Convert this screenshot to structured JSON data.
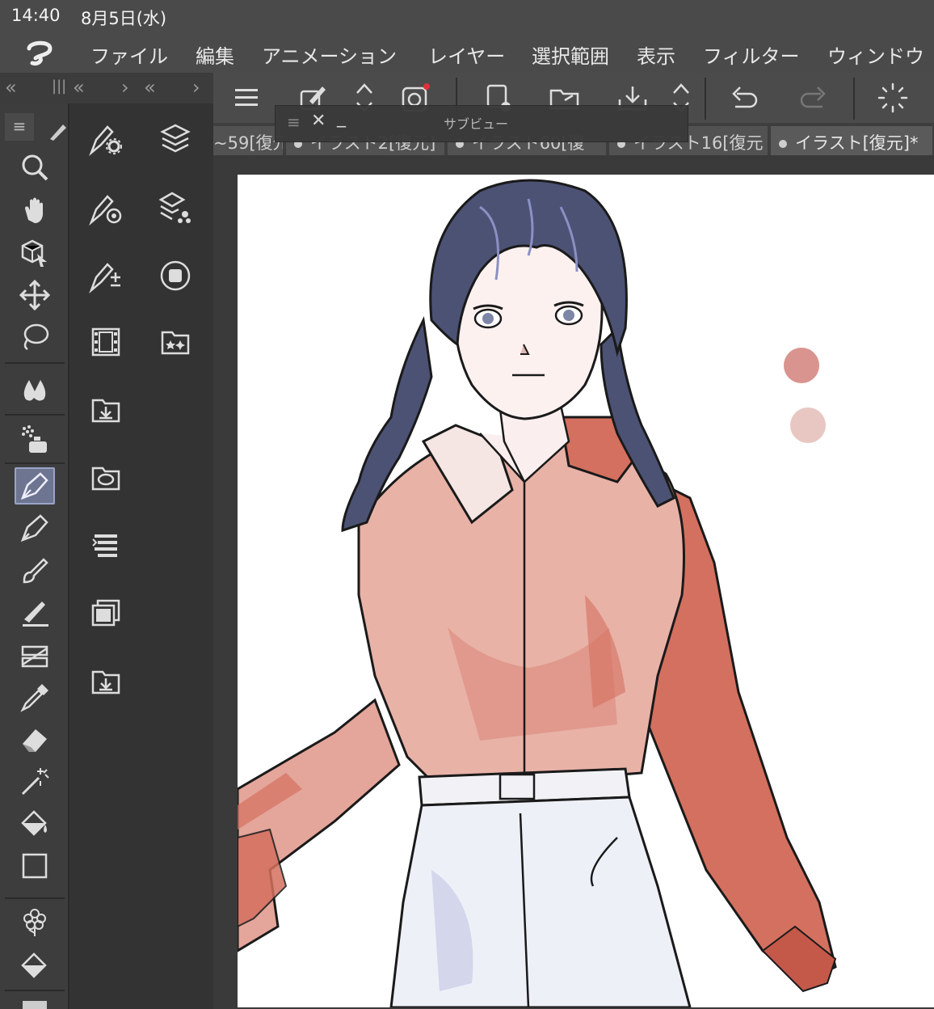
{
  "status": {
    "time": "14:40",
    "date": "8月5日(水)"
  },
  "menu": {
    "items": [
      {
        "label": "ファイル"
      },
      {
        "label": "編集"
      },
      {
        "label": "アニメーション"
      },
      {
        "label": "レイヤー"
      },
      {
        "label": "選択範囲"
      },
      {
        "label": "表示"
      },
      {
        "label": "フィルター"
      },
      {
        "label": "ウィンドウ"
      }
    ]
  },
  "panel_header": {
    "collapse_left": "«",
    "grip": "|||",
    "collapse_left2": "«",
    "expand_right": "›",
    "collapse_left3": "«",
    "expand_right2": "›"
  },
  "subview": {
    "title": "サブビュー",
    "menu_icon": "≡",
    "close_icon": "✕",
    "minimize_icon": "_"
  },
  "tabs": [
    {
      "label": "~59[復元"
    },
    {
      "label": "イラスト2[復元]"
    },
    {
      "label": "イラスト60[復"
    },
    {
      "label": "イラスト16[復元"
    },
    {
      "label": "イラスト[復元]*"
    }
  ],
  "tools": [
    "zoom-icon",
    "hand-icon",
    "object-icon",
    "move-icon",
    "lasso-icon",
    "blend-icon",
    "spray-icon",
    "pen-icon",
    "pencil-icon",
    "brush-icon",
    "decoration-icon",
    "ruler-icon",
    "eyedropper-icon",
    "eraser-icon",
    "magic-wand-icon",
    "fill-icon",
    "rectangle-icon",
    "flower-icon",
    "gradient-icon"
  ],
  "palettes": [
    "tool-property-icon",
    "layer-icon",
    "sub-tool-detail-icon",
    "layer-property-icon",
    "brush-size-icon",
    "navigator-icon",
    "animation-timeline-icon",
    "material-icon",
    "import-icon",
    "balloon-icon",
    "auto-action-icon",
    "layer-search-icon",
    "import-2-icon"
  ],
  "colors": {
    "shirt": "#e4a59a",
    "shirt_shadow": "#d4705f",
    "hair": "#4c5274",
    "pants": "#eef0f8",
    "swatch_1": "#d9948f",
    "swatch_2": "#e8c7c3",
    "active_tool": "#6d7590"
  }
}
